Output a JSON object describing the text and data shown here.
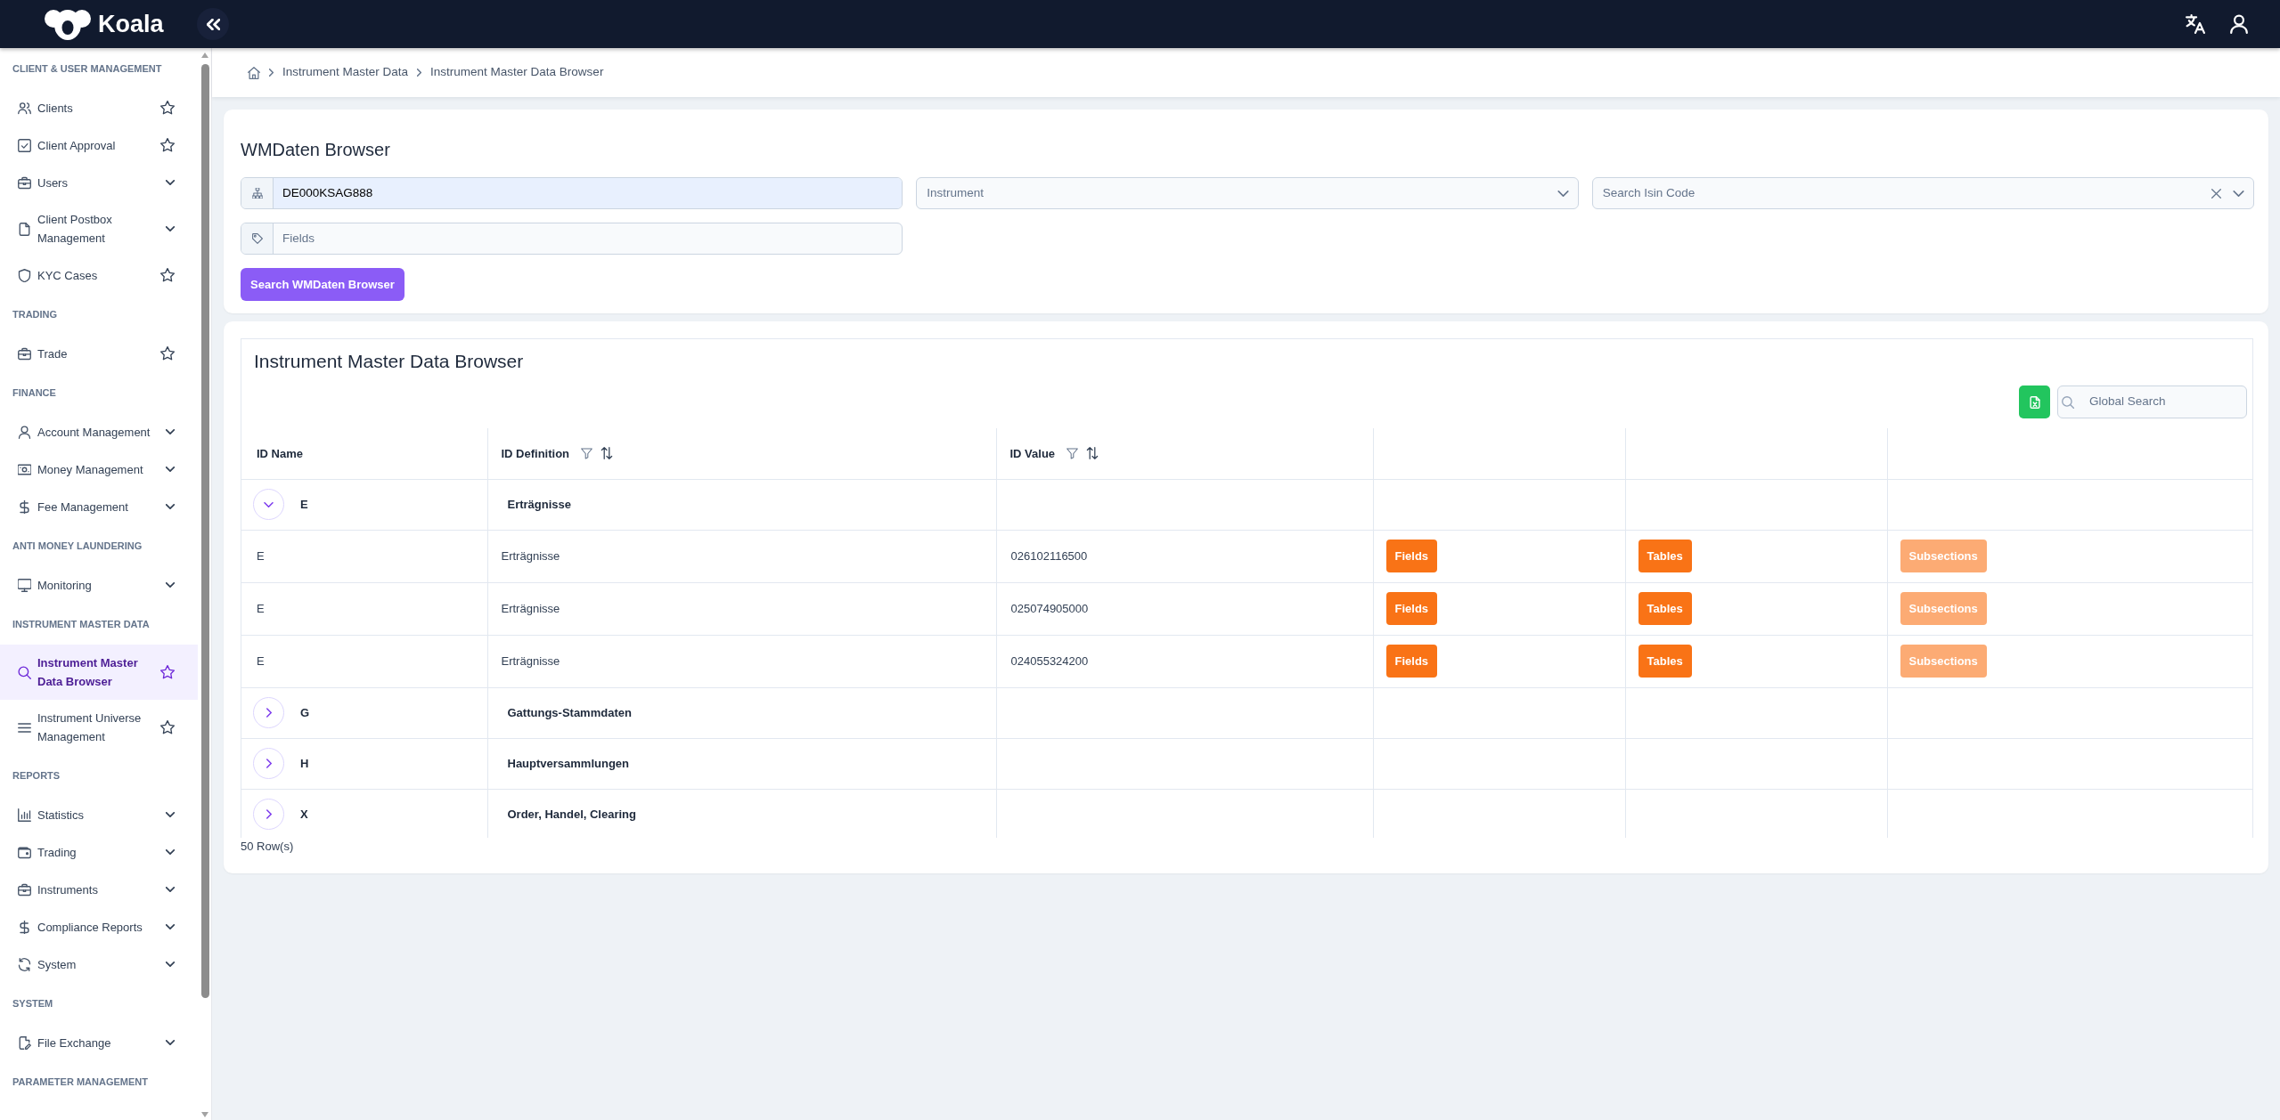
{
  "top_bar": {
    "logo": "Koala"
  },
  "sidebar": {
    "sections": [
      {
        "title": "CLIENT & USER MANAGEMENT",
        "items": [
          {
            "label": "Clients",
            "kind": "link",
            "selected": false
          },
          {
            "label": "Client Approval",
            "kind": "link",
            "selected": false
          },
          {
            "label": "Users",
            "kind": "menu",
            "selected": false
          },
          {
            "label": "Client Postbox Management",
            "kind": "menu",
            "selected": false
          },
          {
            "label": "KYC Cases",
            "kind": "link",
            "selected": false
          }
        ]
      },
      {
        "title": "TRADING",
        "items": [
          {
            "label": "Trade",
            "kind": "link",
            "selected": false
          }
        ]
      },
      {
        "title": "FINANCE",
        "items": [
          {
            "label": "Account Management",
            "kind": "menu",
            "selected": false
          },
          {
            "label": "Money Management",
            "kind": "menu",
            "selected": false
          },
          {
            "label": "Fee Management",
            "kind": "menu",
            "selected": false
          }
        ]
      },
      {
        "title": "ANTI MONEY LAUNDERING",
        "items": [
          {
            "label": "Monitoring",
            "kind": "menu",
            "selected": false
          }
        ]
      },
      {
        "title": "INSTRUMENT MASTER DATA",
        "items": [
          {
            "label": "Instrument Master Data Browser",
            "kind": "link",
            "selected": true
          },
          {
            "label": "Instrument Universe Management",
            "kind": "link",
            "selected": false
          }
        ]
      },
      {
        "title": "REPORTS",
        "items": [
          {
            "label": "Statistics",
            "kind": "menu",
            "selected": false
          },
          {
            "label": "Trading",
            "kind": "menu",
            "selected": false
          },
          {
            "label": "Instruments",
            "kind": "menu",
            "selected": false
          },
          {
            "label": "Compliance Reports",
            "kind": "menu",
            "selected": false
          },
          {
            "label": "System",
            "kind": "menu",
            "selected": false
          }
        ]
      },
      {
        "title": "SYSTEM",
        "items": [
          {
            "label": "File Exchange",
            "kind": "menu",
            "selected": false
          }
        ]
      },
      {
        "title": "PARAMETER MANAGEMENT"
      }
    ]
  },
  "breadcrumb": [
    "Instrument Master Data",
    "Instrument Master Data Browser"
  ],
  "search_card": {
    "title": "WMDaten Browser",
    "isin_field": {
      "value": "DE000KSAG888"
    },
    "instrument_select": {
      "placeholder": "Instrument"
    },
    "isin_code_select": {
      "placeholder": "Search Isin Code"
    },
    "fields_field": {
      "placeholder": "Fields"
    },
    "search_button": "Search WMDaten Browser"
  },
  "table_card": {
    "title": "Instrument Master Data Browser",
    "global_search": {
      "placeholder": "Global Search"
    },
    "columns": [
      {
        "label": "ID Name",
        "filterable": false,
        "sortable": false
      },
      {
        "label": "ID Definition",
        "filterable": true,
        "sortable": true
      },
      {
        "label": "ID Value",
        "filterable": true,
        "sortable": true
      }
    ],
    "groups": [
      {
        "id_name": "E",
        "id_definition": "Erträgnisse",
        "expanded": true,
        "children": [
          {
            "id_name": "E",
            "id_definition": "Erträgnisse",
            "id_value": "026102116500",
            "actions": [
              {
                "label": "Fields",
                "disabled": false
              },
              {
                "label": "Tables",
                "disabled": false
              },
              {
                "label": "Subsections",
                "disabled": true
              }
            ]
          },
          {
            "id_name": "E",
            "id_definition": "Erträgnisse",
            "id_value": "025074905000",
            "actions": [
              {
                "label": "Fields",
                "disabled": false
              },
              {
                "label": "Tables",
                "disabled": false
              },
              {
                "label": "Subsections",
                "disabled": true
              }
            ]
          },
          {
            "id_name": "E",
            "id_definition": "Erträgnisse",
            "id_value": "024055324200",
            "actions": [
              {
                "label": "Fields",
                "disabled": false
              },
              {
                "label": "Tables",
                "disabled": false
              },
              {
                "label": "Subsections",
                "disabled": true
              }
            ]
          }
        ]
      },
      {
        "id_name": "G",
        "id_definition": "Gattungs-Stammdaten",
        "expanded": false
      },
      {
        "id_name": "H",
        "id_definition": "Hauptversammlungen",
        "expanded": false
      },
      {
        "id_name": "X",
        "id_definition": "Order, Handel, Clearing",
        "expanded": false
      }
    ],
    "row_count": "50 Row(s)"
  }
}
